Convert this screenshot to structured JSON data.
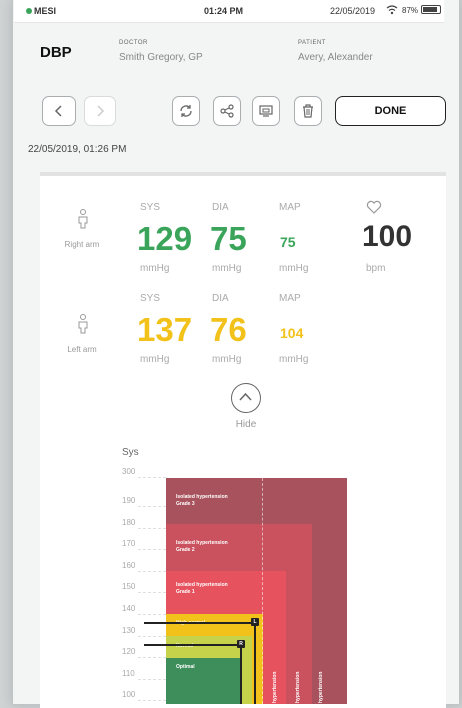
{
  "status": {
    "carrier": "MESI",
    "time": "01:24 PM",
    "date": "22/05/2019",
    "battery": "87%"
  },
  "header": {
    "title": "DBP",
    "doctor_label": "DOCTOR",
    "doctor": "Smith Gregory, GP",
    "patient_label": "PATIENT",
    "patient": "Avery, Alexander"
  },
  "toolbar": {
    "done_label": "DONE"
  },
  "timestamp": "22/05/2019, 01:26 PM",
  "readings": {
    "right": {
      "label": "Right arm",
      "sys_label": "SYS",
      "dia_label": "DIA",
      "map_label": "MAP",
      "sys": "129",
      "dia": "75",
      "map": "75",
      "pulse": "100",
      "unit": "mmHg",
      "pulse_unit": "bpm"
    },
    "left": {
      "label": "Left arm",
      "sys_label": "SYS",
      "dia_label": "DIA",
      "map_label": "MAP",
      "sys": "137",
      "dia": "76",
      "map": "104",
      "unit": "mmHg"
    }
  },
  "hide_label": "Hide",
  "colors": {
    "green": "#3aa55a",
    "yellow": "#f2c21b",
    "grade3": "#a7525c",
    "grade2": "#c9525e",
    "grade1": "#e6535f"
  },
  "bp_chart": {
    "axis_label": "Sys",
    "ticks": [
      "300",
      "190",
      "180",
      "170",
      "160",
      "150",
      "140",
      "130",
      "120",
      "110",
      "100"
    ],
    "zones": {
      "g3a": "Isolated hypertension",
      "g3b": "Grade 3",
      "g2a": "Isolated hypertension",
      "g2b": "Grade 2",
      "g1a": "Isolated hypertension",
      "g1b": "Grade 1",
      "high_normal": "High normal",
      "normal": "Normal",
      "optimal": "Optimal",
      "v1": "hypertension",
      "v2": "hypertension",
      "v3": "hypertension"
    },
    "markers": {
      "left": "L",
      "right": "R"
    }
  }
}
